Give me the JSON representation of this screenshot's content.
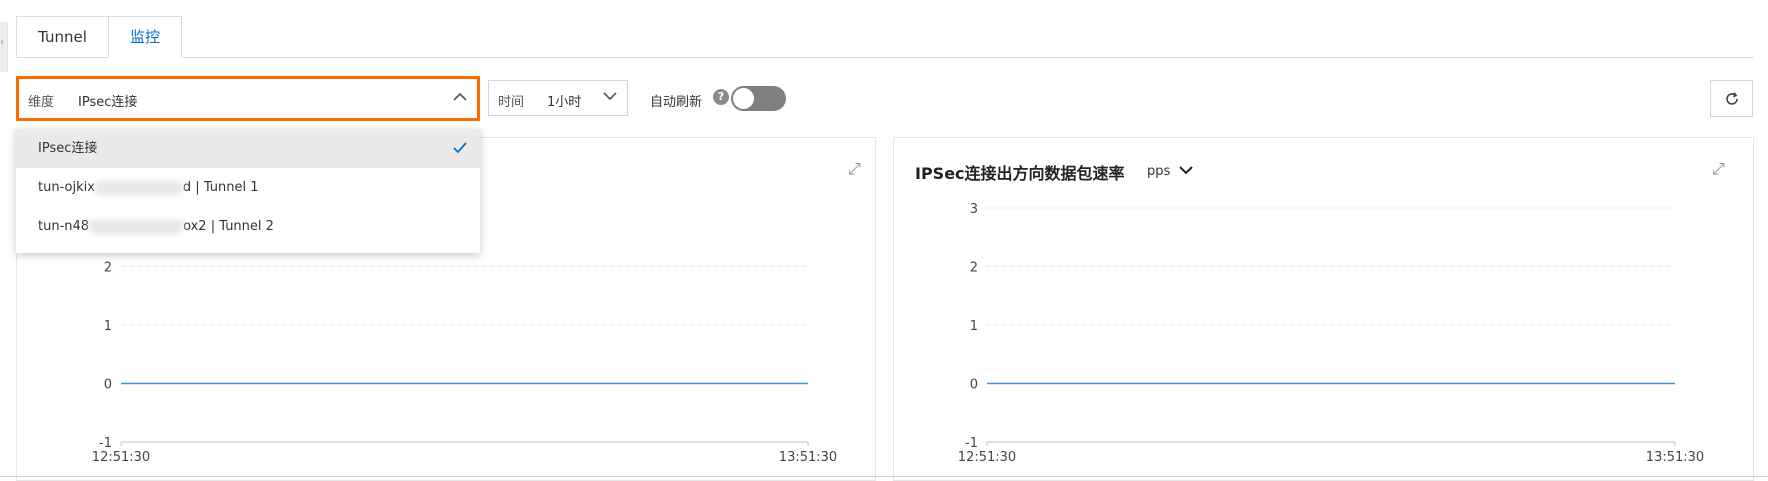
{
  "tabs": [
    {
      "label": "Tunnel",
      "active": false
    },
    {
      "label": "监控",
      "active": true
    }
  ],
  "filters": {
    "dimension_label": "维度",
    "dimension_value": "IPsec连接",
    "time_label": "时间",
    "time_value": "1小时",
    "auto_refresh_label": "自动刷新",
    "help_glyph": "?",
    "auto_refresh_on": false
  },
  "dimension_dropdown": {
    "options": [
      {
        "label": "IPsec连接",
        "selected": true
      },
      {
        "prefix": "tun-ojkix",
        "suffix": "d | Tunnel 1",
        "selected": false
      },
      {
        "prefix": "tun-n48",
        "suffix": "ox2 | Tunnel 2",
        "selected": false
      }
    ]
  },
  "charts_panel": {
    "right_title": "IPSec连接出方向数据包速率",
    "right_unit": "pps"
  },
  "icons": {
    "refresh": "refresh-icon",
    "expand": "expand-icon",
    "check": "check-icon",
    "chevron": "chevron-down-icon",
    "help": "help-icon"
  },
  "colors": {
    "accent": "#0070cc",
    "highlight_border": "#ff6a00",
    "series": "#3b8fe0",
    "toggle_off": "#7f7f7f"
  },
  "chart_data": [
    {
      "type": "line",
      "title": "",
      "x": [
        "12:51:30",
        "13:51:30"
      ],
      "series": [
        {
          "values": [
            0,
            0
          ]
        }
      ],
      "yticks": [
        2,
        1,
        0,
        -1
      ],
      "ylim": [
        -1,
        3
      ],
      "grid": true,
      "xlabel": "",
      "ylabel": ""
    },
    {
      "type": "line",
      "title": "IPSec连接出方向数据包速率",
      "x": [
        "12:51:30",
        "13:51:30"
      ],
      "series": [
        {
          "values": [
            0,
            0
          ]
        }
      ],
      "yticks": [
        3,
        2,
        1,
        0,
        -1
      ],
      "ylim": [
        -1,
        3
      ],
      "grid": true,
      "xlabel": "",
      "ylabel": ""
    }
  ]
}
